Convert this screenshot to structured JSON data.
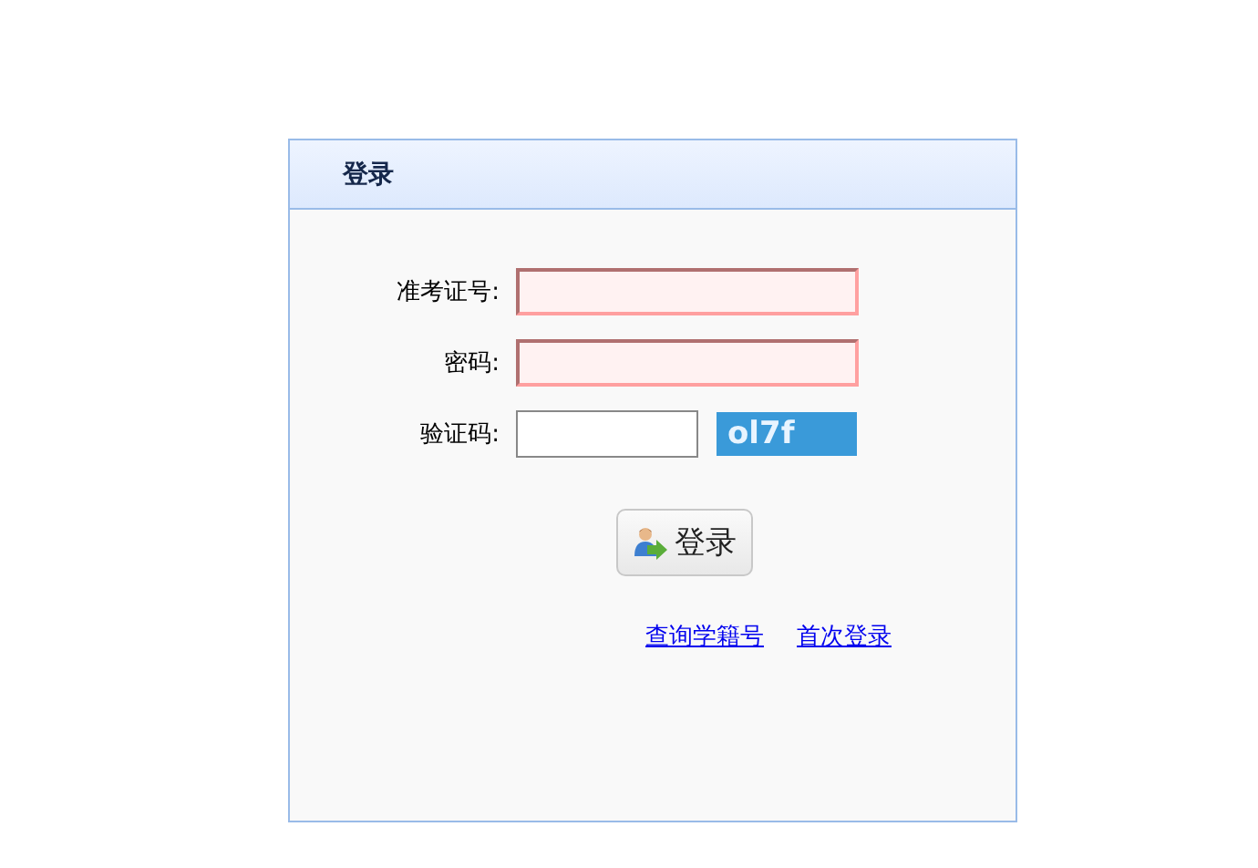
{
  "panel": {
    "title": "登录"
  },
  "fields": [
    {
      "label": "准考证号:",
      "kind": "text",
      "highlighted": true
    },
    {
      "label": "密码:",
      "kind": "password",
      "highlighted": true
    },
    {
      "label": "验证码:",
      "kind": "captcha",
      "highlighted": false,
      "captcha": "ol7f"
    }
  ],
  "login_button": {
    "label": "登录"
  },
  "links": [
    "查询学籍号",
    "首次登录"
  ]
}
